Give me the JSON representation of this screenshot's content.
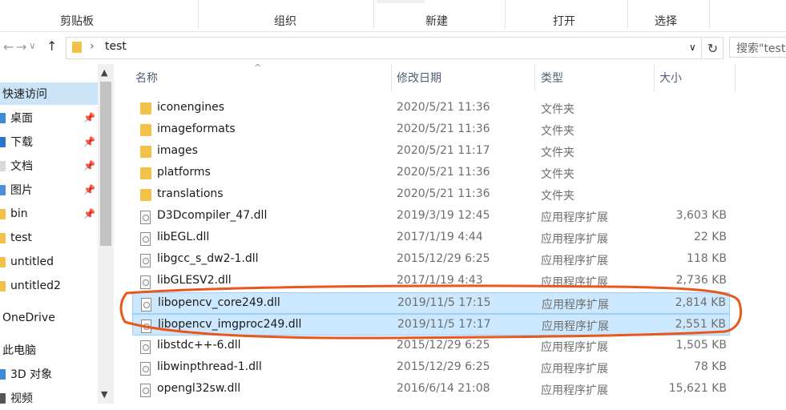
{
  "ribbon": {
    "groups": [
      "剪贴板",
      "组织",
      "新建",
      "打开",
      "选择"
    ]
  },
  "nav": {
    "back": "←",
    "forward": "→",
    "dropdown": "∨",
    "up": "↑",
    "chevron": "›",
    "path": "test",
    "addr_dropdown": "∨",
    "refresh": "↻",
    "search_placeholder": "搜索\"test\""
  },
  "sidebar": {
    "items": [
      {
        "label": "快速访问",
        "pinned": false
      },
      {
        "label": "桌面",
        "pinned": true
      },
      {
        "label": "下载",
        "pinned": true
      },
      {
        "label": "文档",
        "pinned": true
      },
      {
        "label": "图片",
        "pinned": true
      },
      {
        "label": "bin",
        "pinned": true
      },
      {
        "label": "test",
        "pinned": false
      },
      {
        "label": "untitled",
        "pinned": false
      },
      {
        "label": "untitled2",
        "pinned": false
      },
      {
        "label": "OneDrive",
        "pinned": false
      },
      {
        "label": "此电脑",
        "pinned": false
      },
      {
        "label": "3D 对象",
        "pinned": false
      },
      {
        "label": "视频",
        "pinned": false
      }
    ],
    "pin_glyph": "📌"
  },
  "columns": {
    "name": "名称",
    "date": "修改日期",
    "type": "类型",
    "size": "大小",
    "sort_glyph": "^"
  },
  "files": [
    {
      "name": "iconengines",
      "date": "2020/5/21 11:36",
      "type": "文件夹",
      "size": "",
      "kind": "folder"
    },
    {
      "name": "imageformats",
      "date": "2020/5/21 11:36",
      "type": "文件夹",
      "size": "",
      "kind": "folder"
    },
    {
      "name": "images",
      "date": "2020/5/21 11:17",
      "type": "文件夹",
      "size": "",
      "kind": "folder"
    },
    {
      "name": "platforms",
      "date": "2020/5/21 11:36",
      "type": "文件夹",
      "size": "",
      "kind": "folder"
    },
    {
      "name": "translations",
      "date": "2020/5/21 11:36",
      "type": "文件夹",
      "size": "",
      "kind": "folder"
    },
    {
      "name": "D3Dcompiler_47.dll",
      "date": "2019/3/19 12:45",
      "type": "应用程序扩展",
      "size": "3,603 KB",
      "kind": "dll"
    },
    {
      "name": "libEGL.dll",
      "date": "2017/1/19 4:44",
      "type": "应用程序扩展",
      "size": "22 KB",
      "kind": "dll"
    },
    {
      "name": "libgcc_s_dw2-1.dll",
      "date": "2015/12/29 6:25",
      "type": "应用程序扩展",
      "size": "118 KB",
      "kind": "dll"
    },
    {
      "name": "libGLESV2.dll",
      "date": "2017/1/19 4:43",
      "type": "应用程序扩展",
      "size": "2,736 KB",
      "kind": "dll"
    },
    {
      "name": "libopencv_core249.dll",
      "date": "2019/11/5 17:15",
      "type": "应用程序扩展",
      "size": "2,814 KB",
      "kind": "dll",
      "selected": true
    },
    {
      "name": "libopencv_imgproc249.dll",
      "date": "2019/11/5 17:17",
      "type": "应用程序扩展",
      "size": "2,551 KB",
      "kind": "dll",
      "selected": true
    },
    {
      "name": "libstdc++-6.dll",
      "date": "2015/12/29 6:25",
      "type": "应用程序扩展",
      "size": "1,505 KB",
      "kind": "dll"
    },
    {
      "name": "libwinpthread-1.dll",
      "date": "2015/12/29 6:25",
      "type": "应用程序扩展",
      "size": "78 KB",
      "kind": "dll"
    },
    {
      "name": "opengl32sw.dll",
      "date": "2016/6/14 21:08",
      "type": "应用程序扩展",
      "size": "15,621 KB",
      "kind": "dll"
    }
  ],
  "colors": {
    "selection_bg": "#cce8ff",
    "selection_border": "#99d1ff",
    "annotation": "#e8581c",
    "folder": "#f3c147"
  },
  "scroll": {
    "up": "▲",
    "down": "▼"
  }
}
